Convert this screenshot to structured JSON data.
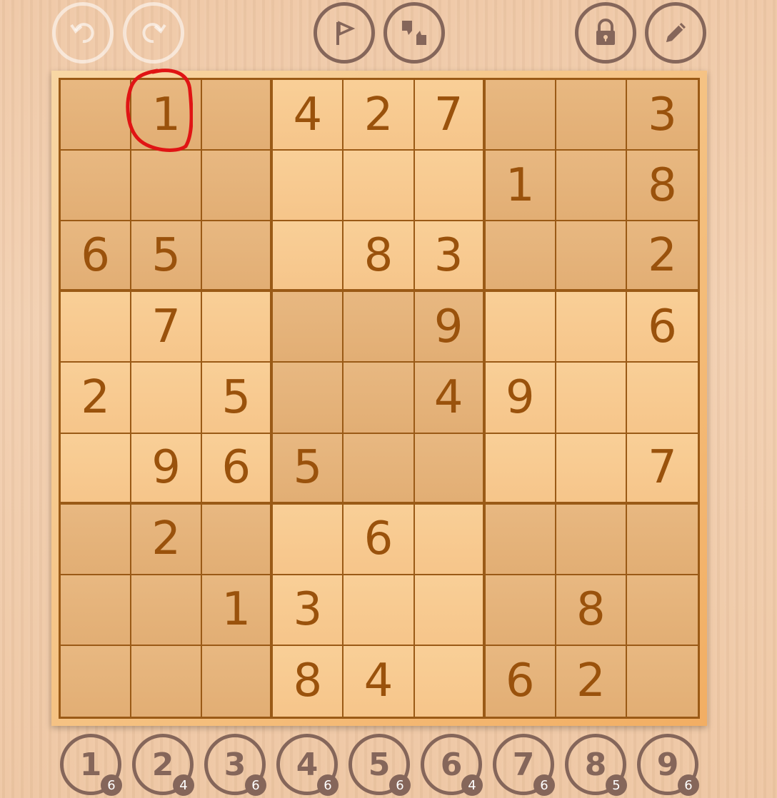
{
  "toolbar": {
    "undo_icon": "undo-icon",
    "redo_icon": "redo-icon",
    "flag_icon": "flag-icon",
    "thumbs_icon": "thumbs-up-down-icon",
    "lock_icon": "lock-icon",
    "pencil_icon": "pencil-icon"
  },
  "board": {
    "rows": [
      [
        "",
        "1",
        "",
        "4",
        "2",
        "7",
        "",
        "",
        "3"
      ],
      [
        "",
        "",
        "",
        "",
        "",
        "",
        "1",
        "",
        "8"
      ],
      [
        "6",
        "5",
        "",
        "",
        "8",
        "3",
        "",
        "",
        "2"
      ],
      [
        "",
        "7",
        "",
        "",
        "",
        "9",
        "",
        "",
        "6"
      ],
      [
        "2",
        "",
        "5",
        "",
        "",
        "4",
        "9",
        "",
        ""
      ],
      [
        "",
        "9",
        "6",
        "5",
        "",
        "",
        "",
        "",
        "7"
      ],
      [
        "",
        "2",
        "",
        "",
        "6",
        "",
        "",
        "",
        ""
      ],
      [
        "",
        "",
        "1",
        "3",
        "",
        "",
        "",
        "8",
        ""
      ],
      [
        "",
        "",
        "",
        "8",
        "4",
        "",
        "6",
        "2",
        ""
      ]
    ]
  },
  "number_pad": [
    {
      "digit": "1",
      "count": "6"
    },
    {
      "digit": "2",
      "count": "4"
    },
    {
      "digit": "3",
      "count": "6"
    },
    {
      "digit": "4",
      "count": "6"
    },
    {
      "digit": "5",
      "count": "6"
    },
    {
      "digit": "6",
      "count": "4"
    },
    {
      "digit": "7",
      "count": "6"
    },
    {
      "digit": "8",
      "count": "5"
    },
    {
      "digit": "9",
      "count": "6"
    }
  ],
  "colors": {
    "digit": "#9a520c",
    "grid_line": "#9a5a16",
    "icon": "#85665a",
    "annotation": "#e01414"
  }
}
